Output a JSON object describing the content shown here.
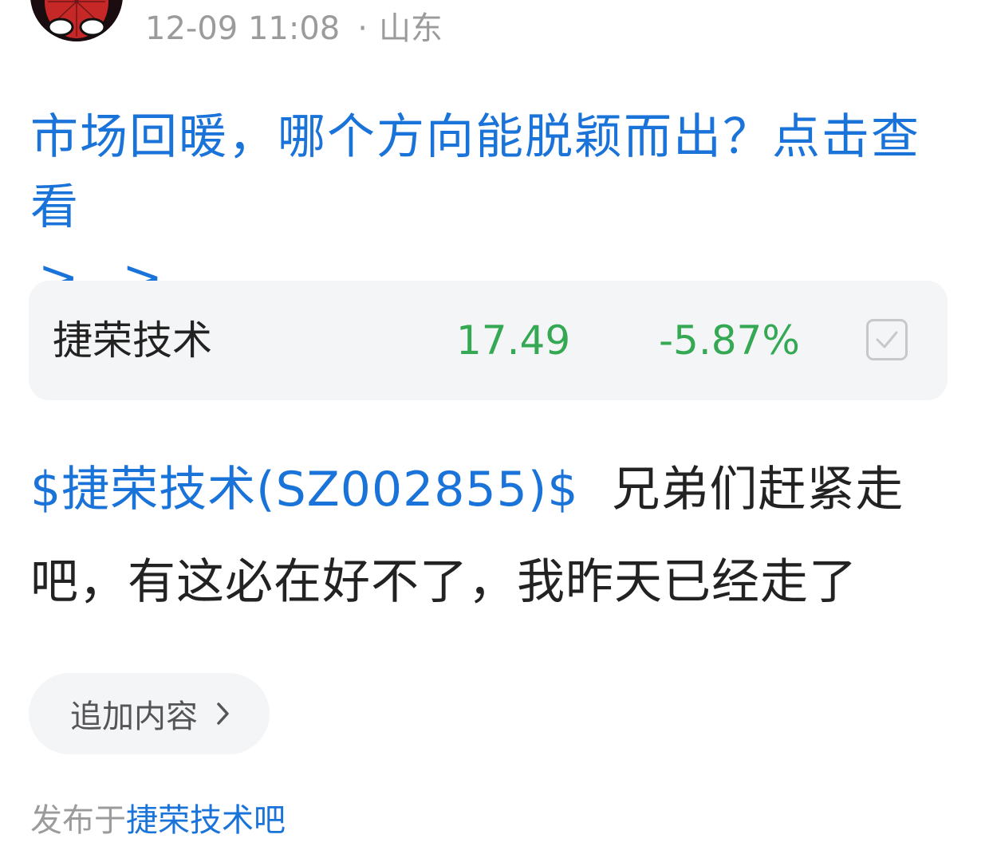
{
  "post": {
    "time": "12-09 11:08",
    "separator": "·",
    "location": "山东"
  },
  "promo": {
    "text": "市场回暖，哪个方向能脱颖而出？点击查看",
    "arrows": "> >"
  },
  "stock_card": {
    "name": "捷荣技术",
    "price": "17.49",
    "change": "-5.87%",
    "color": "#34a853"
  },
  "content": {
    "tag": "$捷荣技术(SZ002855)$",
    "text": "兄弟们赶紧走吧，有这必在好不了，我昨天已经走了"
  },
  "add_button": {
    "label": "追加内容"
  },
  "footer": {
    "prefix": "发布于",
    "forum": "捷荣技术吧"
  },
  "icons": {
    "avatar": "spiderman-avatar",
    "check": "checkbox-icon",
    "chevron": "chevron-right-icon"
  },
  "colors": {
    "link": "#1a73d9",
    "muted": "#9b9b9b",
    "card_bg": "#f4f5f7"
  }
}
